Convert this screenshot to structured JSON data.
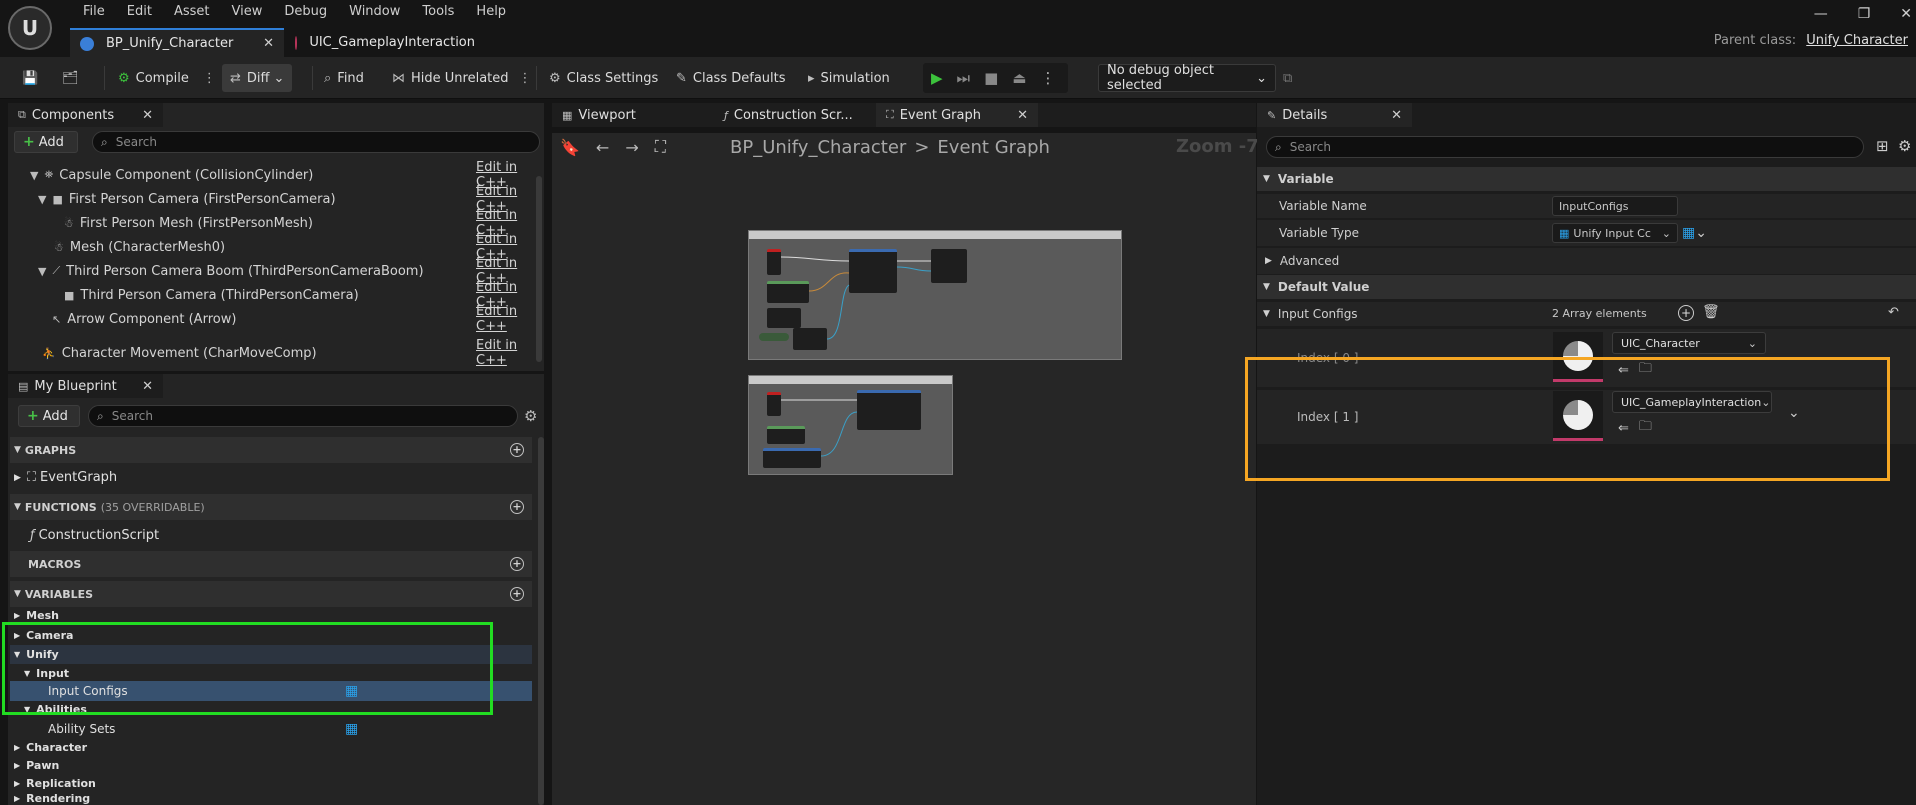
{
  "menu": [
    "File",
    "Edit",
    "Asset",
    "View",
    "Debug",
    "Window",
    "Tools",
    "Help"
  ],
  "tabs": [
    {
      "label": "BP_Unify_Character",
      "active": true
    },
    {
      "label": "UIC_GameplayInteraction",
      "active": false
    }
  ],
  "parent_class": {
    "label": "Parent class:",
    "value": "Unify Character"
  },
  "toolbar": {
    "compile": "Compile",
    "diff": "Diff",
    "find": "Find",
    "hide_unrelated": "Hide Unrelated",
    "class_settings": "Class Settings",
    "class_defaults": "Class Defaults",
    "simulation": "Simulation",
    "debug_object": "No debug object selected"
  },
  "components": {
    "title": "Components",
    "add": "Add",
    "search_placeholder": "Search",
    "edit_label": "Edit in C++",
    "items": [
      {
        "label": "Capsule Component (CollisionCylinder)",
        "level": 0
      },
      {
        "label": "First Person Camera (FirstPersonCamera)",
        "level": 1
      },
      {
        "label": "First Person Mesh (FirstPersonMesh)",
        "level": 2
      },
      {
        "label": "Mesh (CharacterMesh0)",
        "level": 1
      },
      {
        "label": "Third Person Camera Boom (ThirdPersonCameraBoom)",
        "level": 1
      },
      {
        "label": "Third Person Camera (ThirdPersonCamera)",
        "level": 2
      },
      {
        "label": "Arrow Component (Arrow)",
        "level": 1
      },
      {
        "label": "Character Movement (CharMoveComp)",
        "level": 0
      }
    ]
  },
  "my_blueprint": {
    "title": "My Blueprint",
    "add": "Add",
    "search_placeholder": "Search",
    "graphs": "GRAPHS",
    "event_graph": "EventGraph",
    "functions": "FUNCTIONS",
    "functions_sub": "(35 OVERRIDABLE)",
    "construction_script": "ConstructionScript",
    "macros": "MACROS",
    "variables": "VARIABLES",
    "var_items": [
      {
        "label": "Mesh",
        "indent": 0
      },
      {
        "label": "Camera",
        "indent": 0
      },
      {
        "label": "Unify",
        "indent": 0
      },
      {
        "label": "Input",
        "indent": 1
      },
      {
        "label": "Input Configs",
        "indent": 2
      },
      {
        "label": "Abilities",
        "indent": 1
      },
      {
        "label": "Ability Sets",
        "indent": 2
      },
      {
        "label": "Character",
        "indent": 0
      },
      {
        "label": "Pawn",
        "indent": 0
      },
      {
        "label": "Replication",
        "indent": 0
      },
      {
        "label": "Rendering",
        "indent": 0
      }
    ]
  },
  "graph_tabs": [
    {
      "label": "Viewport"
    },
    {
      "label": "Construction Scr..."
    },
    {
      "label": "Event Graph"
    }
  ],
  "graph": {
    "breadcrumb_root": "BP_Unify_Character",
    "breadcrumb_sep": ">",
    "breadcrumb_leaf": "Event Graph",
    "zoom": "Zoom -7"
  },
  "details": {
    "title": "Details",
    "search_placeholder": "Search",
    "variable_cat": "Variable",
    "variable_name_label": "Variable Name",
    "variable_name_value": "InputConfigs",
    "variable_type_label": "Variable Type",
    "variable_type_value": "Unify Input Cc",
    "advanced": "Advanced",
    "default_value_cat": "Default Value",
    "input_configs_label": "Input Configs",
    "array_count": "2 Array elements",
    "elements": [
      {
        "index": "Index [ 0 ]",
        "value": "UIC_Character"
      },
      {
        "index": "Index [ 1 ]",
        "value": "UIC_GameplayInteraction"
      }
    ]
  },
  "colors": {
    "highlight_green": "#22dd22",
    "highlight_orange": "#f5a623",
    "accent_blue": "#2f7fd8",
    "play_green": "#3cc23c"
  }
}
